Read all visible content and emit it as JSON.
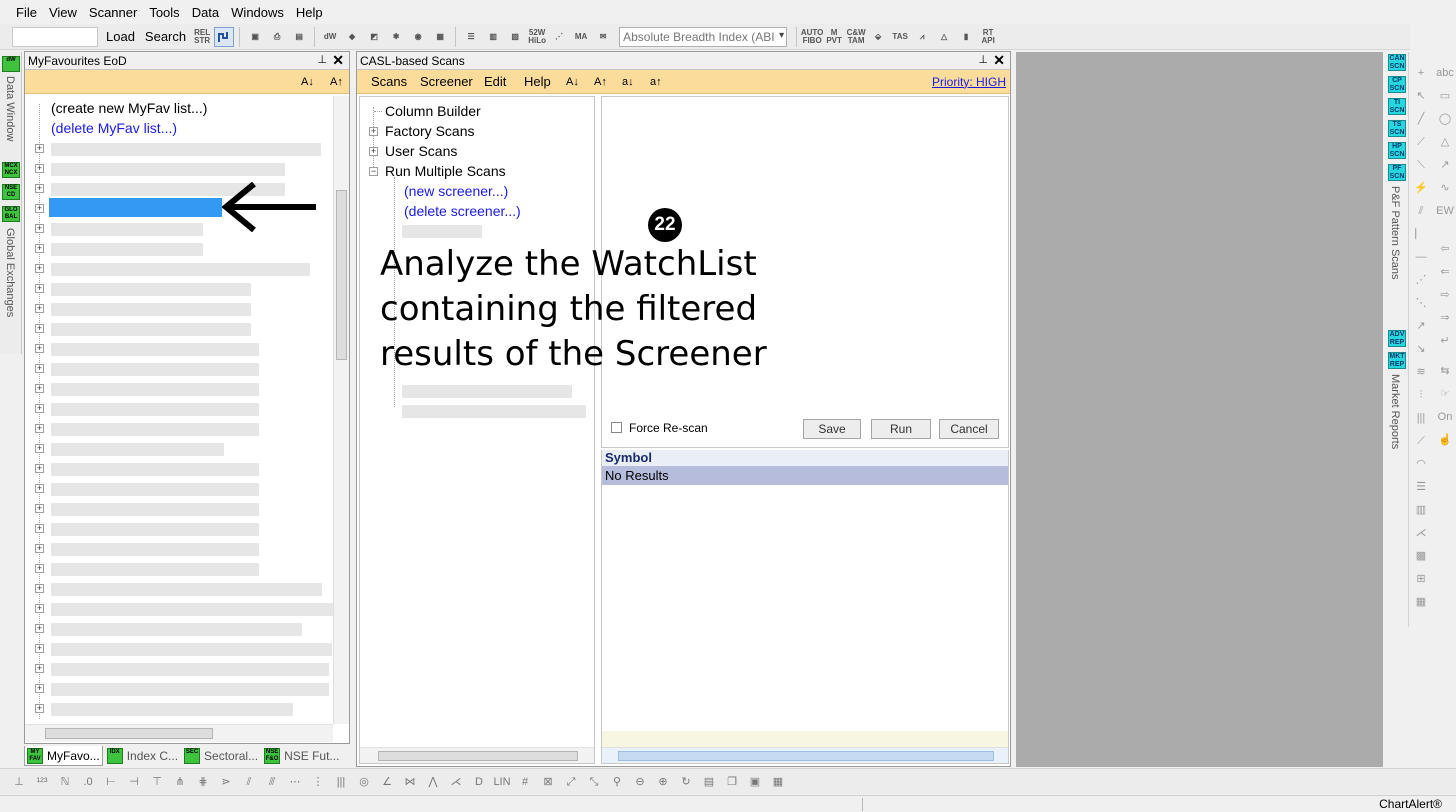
{
  "menu": [
    "File",
    "View",
    "Scanner",
    "Tools",
    "Data",
    "Windows",
    "Help"
  ],
  "toolbar": {
    "load": "Load",
    "search": "Search",
    "rel_str": "REL STR",
    "index_combo": "Absolute Breadth Index (ABI",
    "icons": [
      "dW",
      "52W HiLo",
      "MA",
      "AUTO FIBO",
      "M PVT",
      "C&W TAM",
      "TAS",
      "RT API"
    ]
  },
  "left_strip": {
    "dw": "dW",
    "data_window": "Data Window",
    "mcx": "MCX NCX",
    "nse": "NSE CD",
    "global": "GLO BAL",
    "global_exchanges": "Global Exchanges"
  },
  "myfav": {
    "title": "MyFavourites EoD",
    "sort_az": "A↓",
    "sort_za": "A↑",
    "create": "(create new MyFav list...)",
    "delete": "(delete MyFav list...)"
  },
  "bottom_tabs": [
    {
      "icon": "MY FAV",
      "label": "MyFavo..."
    },
    {
      "icon": "IDX",
      "label": "Index C..."
    },
    {
      "icon": "SEC",
      "label": "Sectoral..."
    },
    {
      "icon": "NSE F&O",
      "label": "NSE Fut..."
    }
  ],
  "casl": {
    "title": "CASL-based Scans",
    "menu": [
      "Scans",
      "Screener",
      "Edit",
      "Help",
      "A↓",
      "A↑",
      "a↓",
      "a↑"
    ],
    "priority": "Priority: HIGH",
    "tree": {
      "column_builder": "Column Builder",
      "factory_scans": "Factory Scans",
      "user_scans": "User Scans",
      "run_multiple": "Run Multiple Scans",
      "new_screener": "(new screener...)",
      "delete_screener": "(delete screener...)"
    },
    "force_rescan": "Force Re-scan",
    "buttons": {
      "save": "Save",
      "run": "Run",
      "cancel": "Cancel"
    },
    "results": {
      "header": "Symbol",
      "row": "No Results"
    }
  },
  "annotation": {
    "step": "22",
    "text": "Analyze the WatchList containing the filtered results of the Screener"
  },
  "right_strip": {
    "buttons": [
      "CAN SCN",
      "CP SCN",
      "TI SCN",
      "TS SCN",
      "HP SCN",
      "PF SCN",
      "ADV REP",
      "MKT REP"
    ],
    "pattern_scans": "P&F Pattern Scans",
    "market_reports": "Market Reports"
  },
  "status": {
    "brand": "ChartAlert®"
  }
}
